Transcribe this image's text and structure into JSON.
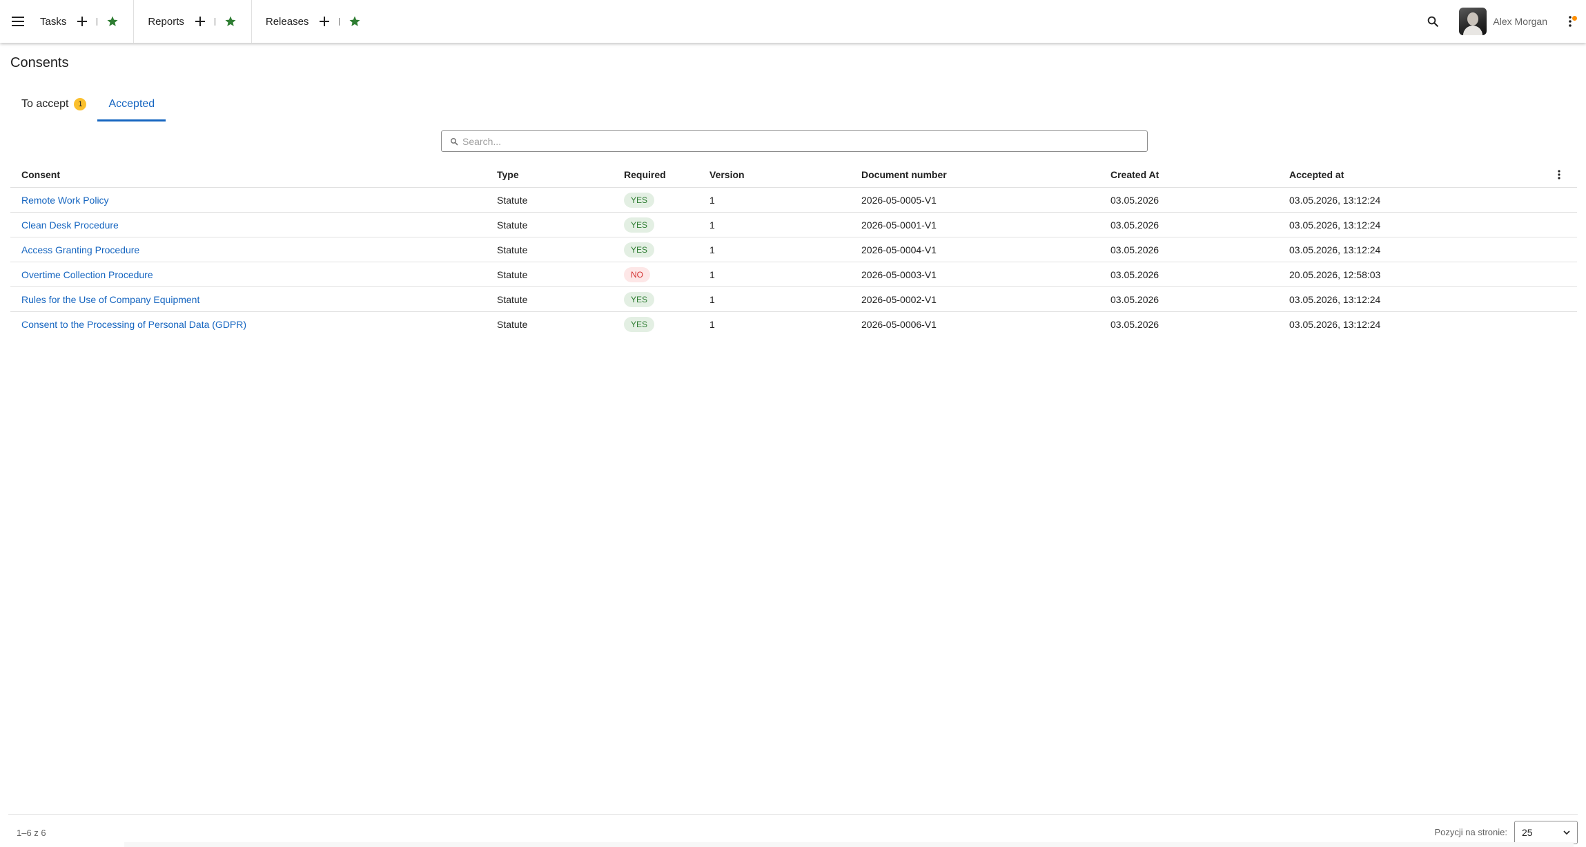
{
  "topbar": {
    "menu_icon": "hamburger-menu-icon",
    "nav": [
      {
        "label": "Tasks"
      },
      {
        "label": "Reports"
      },
      {
        "label": "Releases"
      }
    ],
    "user_name": "Alex Morgan",
    "notification_color": "#ff8f00",
    "star_color": "#2e7d32"
  },
  "page": {
    "title": "Consents",
    "tabs": [
      {
        "label": "To accept",
        "badge": "1"
      },
      {
        "label": "Accepted"
      }
    ],
    "active_tab": "Accepted",
    "search": {
      "placeholder": "Search...",
      "value": ""
    }
  },
  "table": {
    "headers": {
      "consent": "Consent",
      "type": "Type",
      "required": "Required",
      "version": "Version",
      "document_number": "Document number",
      "created_at": "Created At",
      "accepted_at": "Accepted at"
    },
    "rows": [
      {
        "consent": "Remote Work Policy",
        "type": "Statute",
        "required": "YES",
        "version": "1",
        "document_number": "2026-05-0005-V1",
        "created_at": "03.05.2026",
        "accepted_at": "03.05.2026, 13:12:24"
      },
      {
        "consent": "Clean Desk Procedure",
        "type": "Statute",
        "required": "YES",
        "version": "1",
        "document_number": "2026-05-0001-V1",
        "created_at": "03.05.2026",
        "accepted_at": "03.05.2026, 13:12:24"
      },
      {
        "consent": "Access Granting Procedure",
        "type": "Statute",
        "required": "YES",
        "version": "1",
        "document_number": "2026-05-0004-V1",
        "created_at": "03.05.2026",
        "accepted_at": "03.05.2026, 13:12:24"
      },
      {
        "consent": "Overtime Collection Procedure",
        "type": "Statute",
        "required": "NO",
        "version": "1",
        "document_number": "2026-05-0003-V1",
        "created_at": "03.05.2026",
        "accepted_at": "20.05.2026, 12:58:03"
      },
      {
        "consent": "Rules for the Use of Company Equipment",
        "type": "Statute",
        "required": "YES",
        "version": "1",
        "document_number": "2026-05-0002-V1",
        "created_at": "03.05.2026",
        "accepted_at": "03.05.2026, 13:12:24"
      },
      {
        "consent": "Consent to the Processing of Personal Data (GDPR)",
        "type": "Statute",
        "required": "YES",
        "version": "1",
        "document_number": "2026-05-0006-V1",
        "created_at": "03.05.2026",
        "accepted_at": "03.05.2026, 13:12:24"
      }
    ]
  },
  "footer": {
    "range": "1–6 z 6",
    "per_page_label": "Pozycji na stronie:",
    "per_page_value": "25"
  },
  "colors": {
    "link": "#1565c0",
    "badge": "#fbc02d",
    "chip_yes_bg": "#e3efe3",
    "chip_yes_text": "#2e7d32",
    "chip_no_bg": "#fde7e7",
    "chip_no_text": "#d32f2f"
  }
}
